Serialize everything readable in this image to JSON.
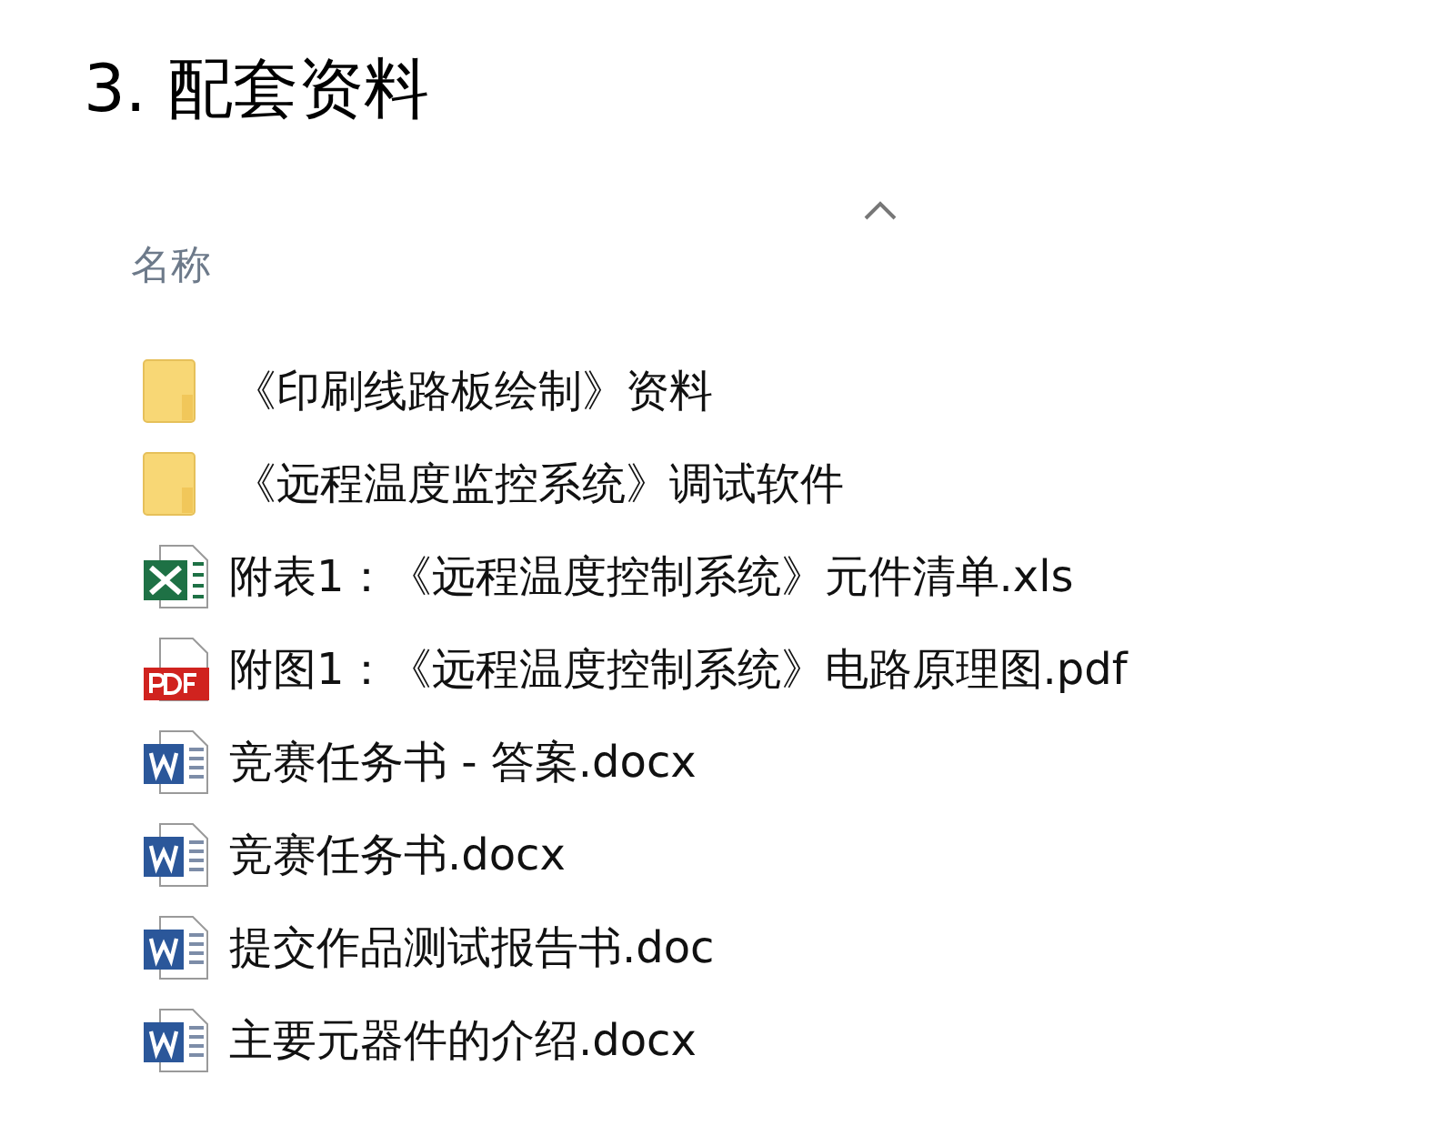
{
  "heading": "3. 配套资料",
  "column": {
    "label": "名称",
    "sorted": true
  },
  "files": [
    {
      "kind": "folder",
      "name": "《印刷线路板绘制》资料"
    },
    {
      "kind": "folder",
      "name": "《远程温度监控系统》调试软件"
    },
    {
      "kind": "excel",
      "name": "附表1：《远程温度控制系统》元件清单.xls"
    },
    {
      "kind": "pdf",
      "name": "附图1：《远程温度控制系统》电路原理图.pdf"
    },
    {
      "kind": "word",
      "name": "竞赛任务书 - 答案.docx"
    },
    {
      "kind": "word",
      "name": "竞赛任务书.docx"
    },
    {
      "kind": "word",
      "name": "提交作品测试报告书.doc"
    },
    {
      "kind": "word",
      "name": "主要元器件的介绍.docx"
    }
  ]
}
